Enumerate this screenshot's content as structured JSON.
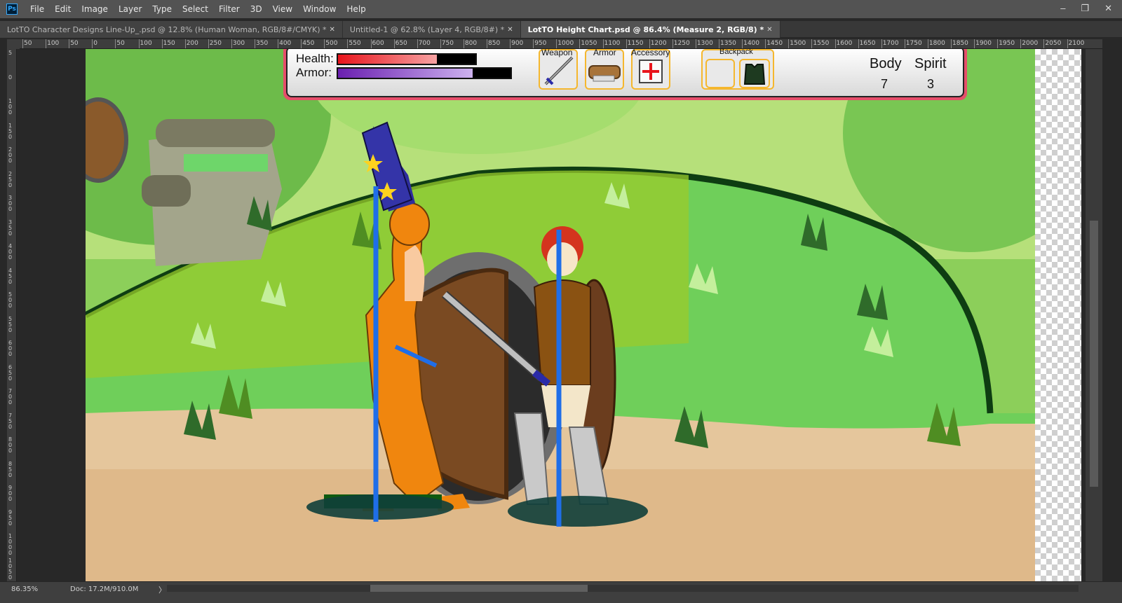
{
  "app": {
    "logo": "Ps",
    "menu": [
      "File",
      "Edit",
      "Image",
      "Layer",
      "Type",
      "Select",
      "Filter",
      "3D",
      "View",
      "Window",
      "Help"
    ]
  },
  "window_controls": {
    "minimize": "–",
    "restore": "❐",
    "close": "✕"
  },
  "tabs": [
    {
      "label": "LotTO Character Designs Line-Up_.psd @ 12.8% (Human Woman, RGB/8#/CMYK) *",
      "close": "✕"
    },
    {
      "label": "Untitled-1 @ 62.8% (Layer 4, RGB/8#) *",
      "close": "✕"
    },
    {
      "label": "LotTO Height Chart.psd @ 86.4% (Measure 2, RGB/8) *",
      "close": "✕"
    }
  ],
  "ruler_h": [
    "50",
    "100",
    "50",
    "0",
    "50",
    "100",
    "150",
    "200",
    "250",
    "300",
    "350",
    "400",
    "450",
    "500",
    "550",
    "600",
    "650",
    "700",
    "750",
    "800",
    "850",
    "900",
    "950",
    "1000",
    "1050",
    "1100",
    "1150",
    "1200",
    "1250",
    "1300",
    "1350",
    "1400",
    "1450",
    "1500",
    "1550",
    "1600",
    "1650",
    "1700",
    "1750",
    "1800",
    "1850",
    "1900",
    "1950",
    "2000",
    "2050",
    "2100"
  ],
  "ruler_v": [
    "5",
    "0",
    "100",
    "150",
    "200",
    "250",
    "300",
    "350",
    "400",
    "450",
    "500",
    "550",
    "600",
    "650",
    "700",
    "750",
    "800",
    "850",
    "900",
    "950",
    "1000",
    "1050"
  ],
  "hud": {
    "health_label": "Health:",
    "armor_label": "Armor:",
    "health_level": 0.72,
    "armor_level": 0.78,
    "weapon_label": "Weapon",
    "armor_slot_label": "Armor",
    "accessory_label": "Accessory",
    "backpack_label": "Backpack",
    "body_label": "Body",
    "body_value": "7",
    "spirit_label": "Spirit",
    "spirit_value": "3"
  },
  "colors": {
    "health": "#e8141c",
    "armor": "#6a1fb0",
    "hud_frame": "#e64e6a",
    "slot_border": "#f5b72e",
    "measure_line": "#1f6ee8"
  },
  "status": {
    "zoom": "86.35%",
    "doc": "Doc: 17.2M/910.0M",
    "arrow": "〉"
  }
}
